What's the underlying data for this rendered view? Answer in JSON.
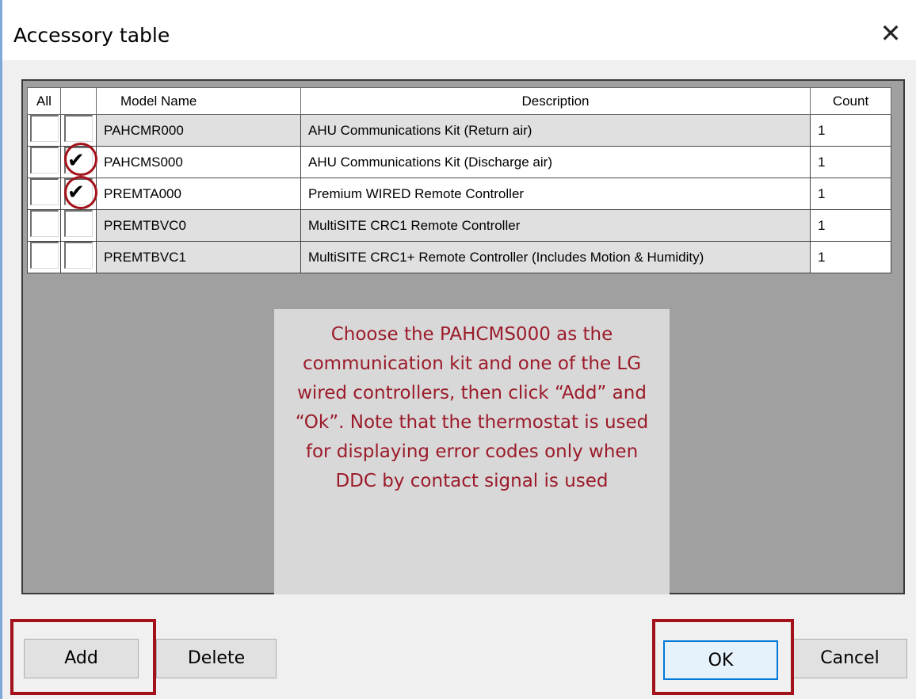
{
  "dialog": {
    "title": "Accessory table",
    "close_icon": "close-icon"
  },
  "table": {
    "columns": [
      "All",
      "",
      "Model Name",
      "Description",
      "Count"
    ],
    "rows": [
      {
        "all_checked": false,
        "checked": false,
        "model": "PAHCMR000",
        "description": "AHU Communications Kit (Return air)",
        "count": "1"
      },
      {
        "all_checked": false,
        "checked": true,
        "model": "PAHCMS000",
        "description": "AHU Communications Kit (Discharge air)",
        "count": "1"
      },
      {
        "all_checked": false,
        "checked": true,
        "model": "PREMTA000",
        "description": "Premium WIRED Remote Controller",
        "count": "1"
      },
      {
        "all_checked": false,
        "checked": false,
        "model": "PREMTBVC0",
        "description": "MultiSITE CRC1 Remote Controller",
        "count": "1"
      },
      {
        "all_checked": false,
        "checked": false,
        "model": "PREMTBVC1",
        "description": "MultiSITE CRC1+ Remote Controller (Includes Motion & Humidity)",
        "count": "1"
      }
    ]
  },
  "note": {
    "text": "Choose the PAHCMS000 as the communication kit and one of the LG wired controllers, then click “Add” and “Ok”. Note that the thermostat is used for displaying error codes only when DDC by contact signal is used"
  },
  "buttons": {
    "add": "Add",
    "delete": "Delete",
    "ok": "OK",
    "cancel": "Cancel"
  },
  "annotation_color": "#a3121b"
}
